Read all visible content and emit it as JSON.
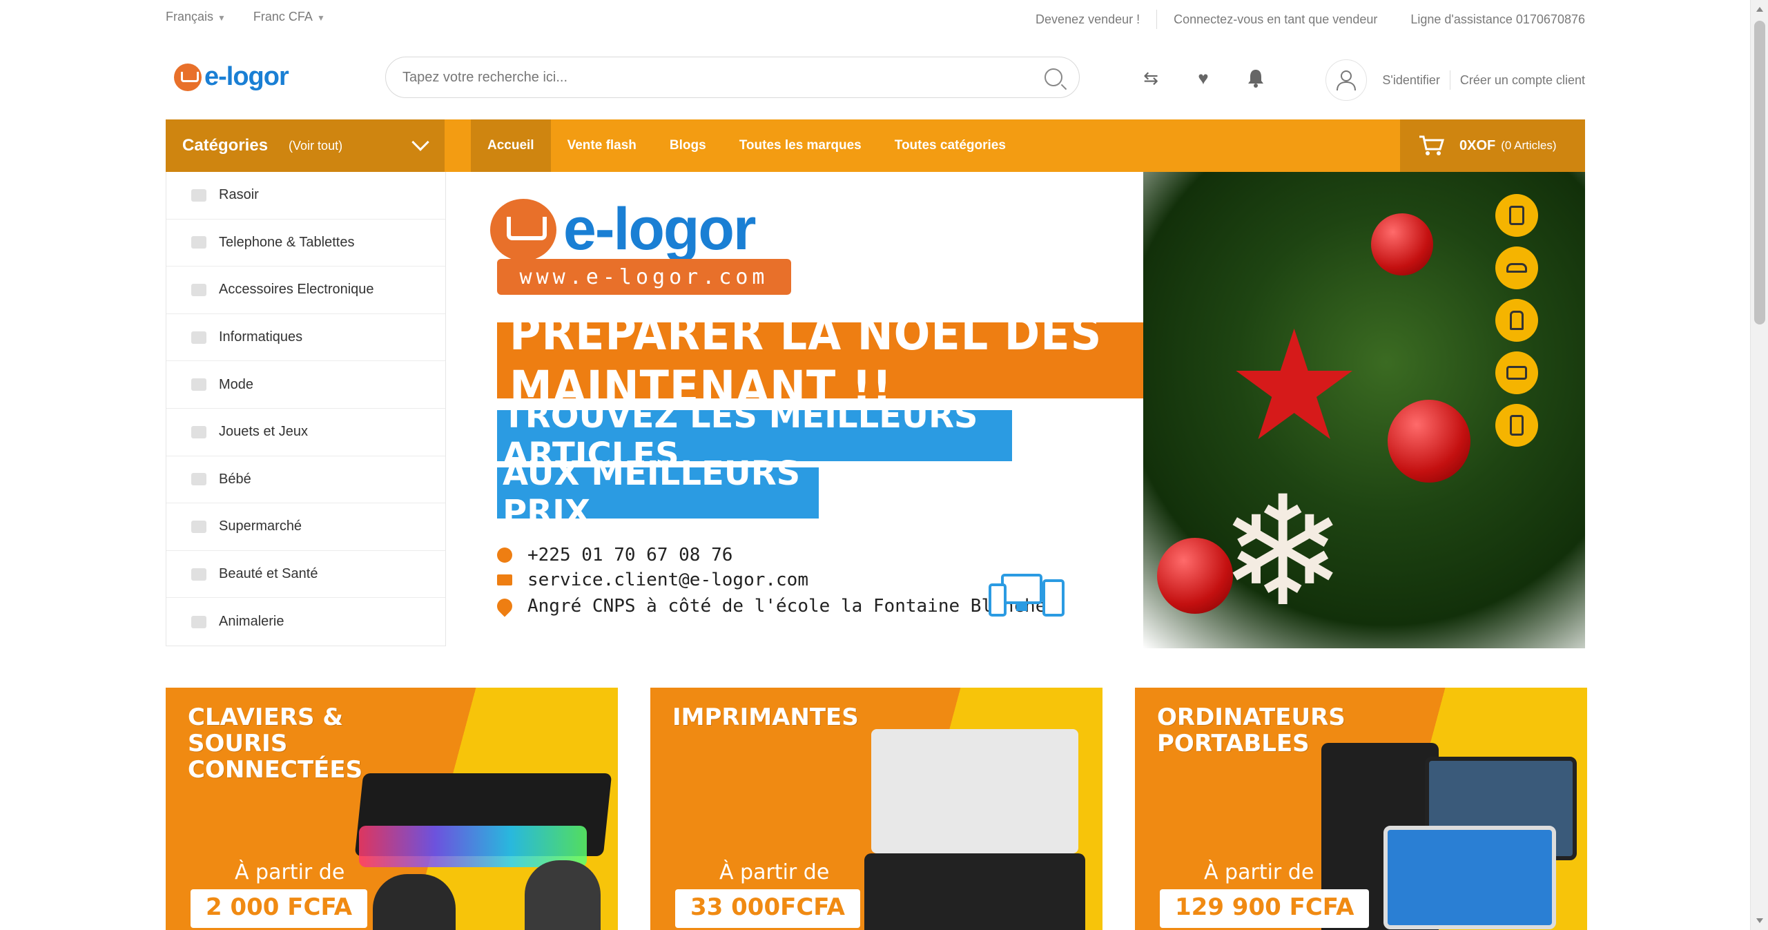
{
  "topbar": {
    "language": "Français",
    "currency": "Franc CFA",
    "become_seller": "Devenez vendeur !",
    "seller_login": "Connectez-vous en tant que vendeur",
    "helpline": "Ligne d'assistance 0170670876"
  },
  "header": {
    "logo_text": "e-logor",
    "search_placeholder": "Tapez votre recherche ici...",
    "sign_in": "S'identifier",
    "create_account": "Créer un compte client"
  },
  "nav": {
    "categories_title": "Catégories",
    "see_all": "(Voir tout)",
    "items": [
      "Accueil",
      "Vente flash",
      "Blogs",
      "Toutes les marques",
      "Toutes catégories"
    ],
    "active_index": 0,
    "cart_amount": "0XOF",
    "cart_count": "(0 Articles)"
  },
  "categories": [
    "Rasoir",
    "Telephone & Tablettes",
    "Accessoires Electronique",
    "Informatiques",
    "Mode",
    "Jouets et Jeux",
    "Bébé",
    "Supermarché",
    "Beauté et Santé",
    "Animalerie"
  ],
  "hero": {
    "logo_text": "e-logor",
    "url": "www.e-logor.com",
    "headline": "PREPARER LA NOËL DÈS MAINTENANT !!",
    "line2": "TROUVEZ LES MEILLEURS ARTICLES",
    "line3": "AUX MEILLEURS PRIX",
    "phone": "+225 01 70 67 08 76",
    "email": "service.client@e-logor.com",
    "address": "Angré CNPS à côté de l'école la Fontaine Blanche"
  },
  "promos": [
    {
      "title": "CLAVIERS & SOURIS CONNECTÉES",
      "from": "À partir de",
      "price": "2 000 FCFA"
    },
    {
      "title": "IMPRIMANTES",
      "from": "À partir de",
      "price": "33 000FCFA"
    },
    {
      "title": "ORDINATEURS PORTABLES",
      "from": "À partir de",
      "price": "129 900 FCFA"
    }
  ],
  "colors": {
    "accent": "#f39c12",
    "accent_dark": "#cf8510",
    "brand_blue": "#1a7fd4",
    "brand_orange": "#e8702a"
  }
}
